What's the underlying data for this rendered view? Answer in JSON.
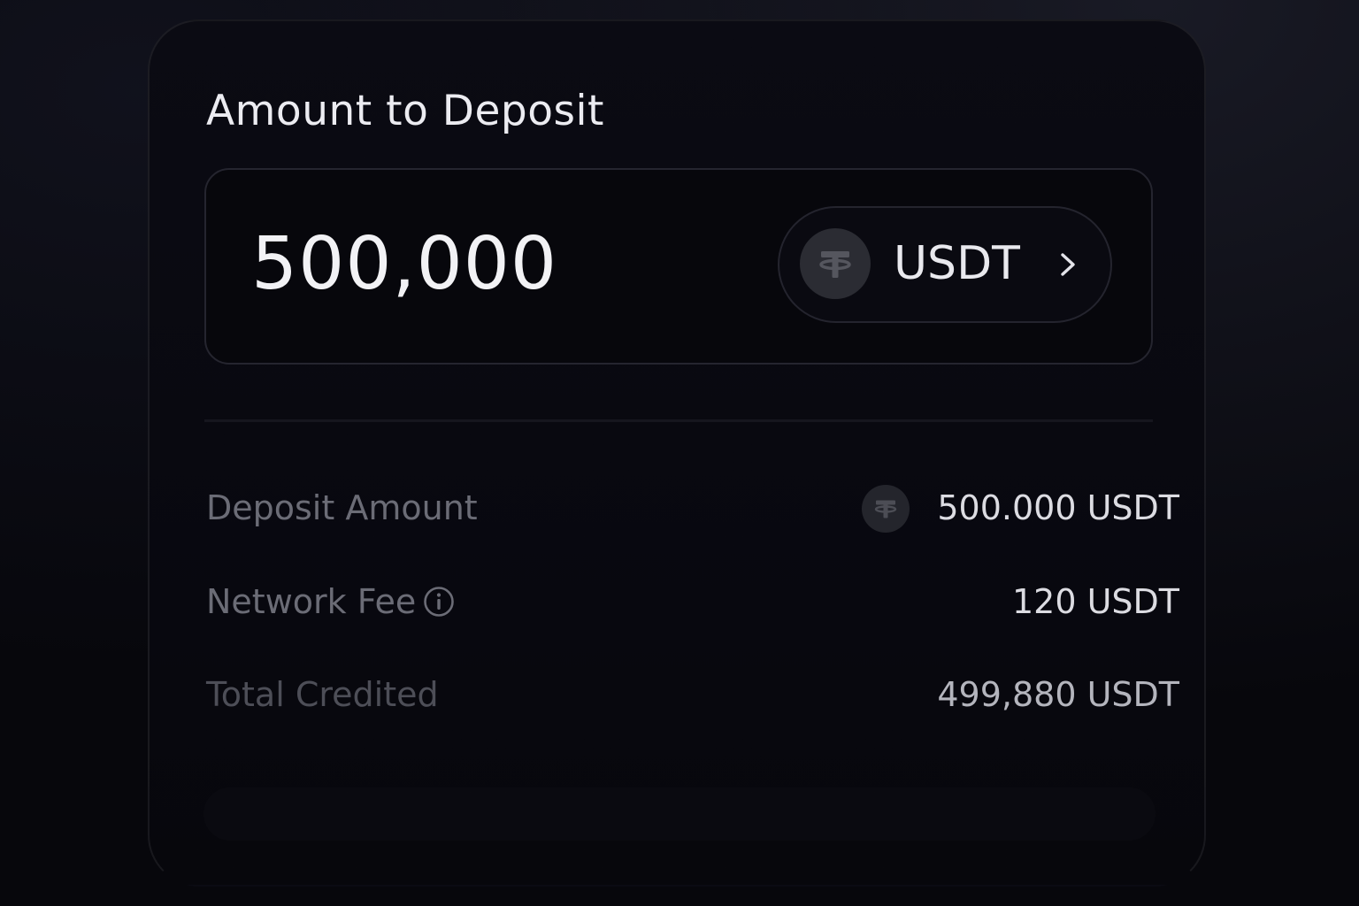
{
  "deposit": {
    "title": "Amount to Deposit",
    "amount_value": "500,000",
    "token": {
      "symbol": "USDT",
      "icon": "tether-icon"
    }
  },
  "summary": {
    "rows": [
      {
        "label": "Deposit Amount",
        "value": "500.000 USDT",
        "icon": "tether-icon"
      },
      {
        "label": "Network Fee",
        "value": "120 USDT",
        "icon": "info-icon"
      },
      {
        "label": "Total Credited",
        "value": "499,880 USDT"
      }
    ]
  },
  "colors": {
    "background": "#07070c",
    "card_border": "#1c1c24",
    "text_primary": "#ececf1",
    "text_muted": "#6b6c76",
    "token_icon_bg": "#2b2c33"
  }
}
